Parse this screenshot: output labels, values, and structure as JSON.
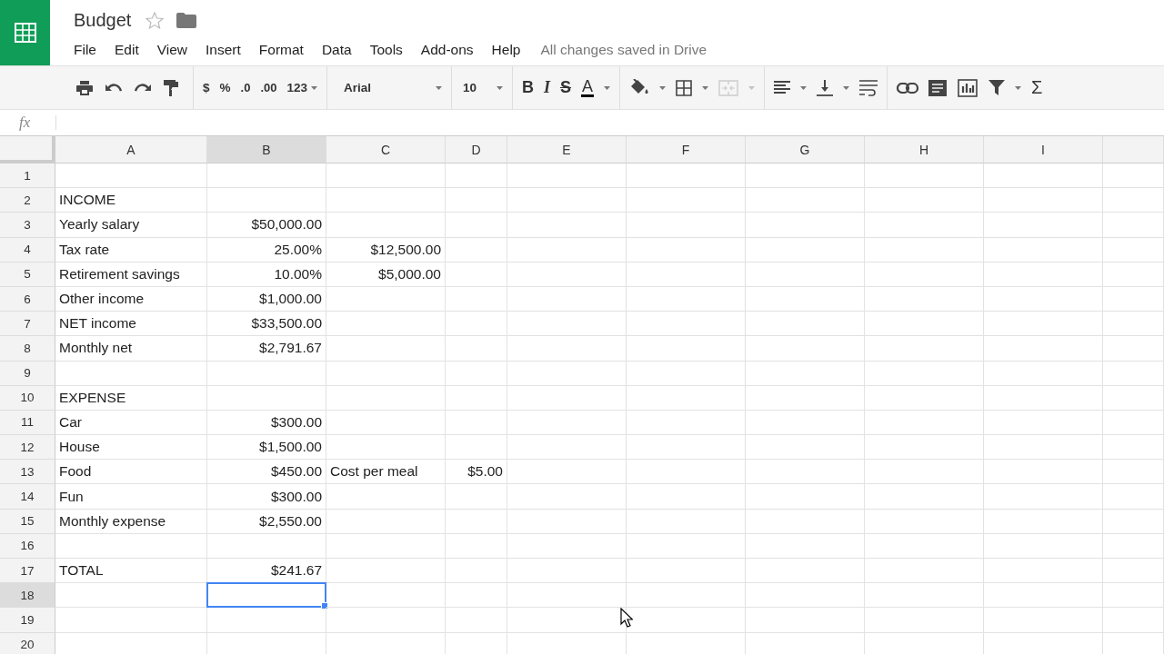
{
  "document": {
    "title": "Budget",
    "starred": false,
    "save_status": "All changes saved in Drive"
  },
  "menus": [
    "File",
    "Edit",
    "View",
    "Insert",
    "Format",
    "Data",
    "Tools",
    "Add-ons",
    "Help"
  ],
  "toolbar": {
    "currency": "$",
    "percent": "%",
    "decrease_decimals": ".0",
    "increase_decimals": ".00",
    "number_format": "123",
    "font": "Arial",
    "font_size": "10",
    "bold": "B",
    "italic": "I",
    "strikethrough": "S",
    "text_color": "A",
    "merge_disabled": true,
    "sum": "Σ"
  },
  "formula_bar": {
    "label": "fx"
  },
  "columns": [
    {
      "label": "A",
      "selected": false
    },
    {
      "label": "B",
      "selected": true
    },
    {
      "label": "C",
      "selected": false
    },
    {
      "label": "D",
      "selected": false
    },
    {
      "label": "E",
      "selected": false
    },
    {
      "label": "F",
      "selected": false
    },
    {
      "label": "G",
      "selected": false
    },
    {
      "label": "H",
      "selected": false
    },
    {
      "label": "I",
      "selected": false
    }
  ],
  "rows": [
    {
      "number": "1",
      "selected": false,
      "cells": []
    },
    {
      "number": "2",
      "selected": false,
      "cells": [
        {
          "kind": "text",
          "text": "INCOME"
        }
      ]
    },
    {
      "number": "3",
      "selected": false,
      "cells": [
        {
          "kind": "text",
          "text": "Yearly salary"
        },
        {
          "kind": "number",
          "text": "$50,000.00"
        }
      ]
    },
    {
      "number": "4",
      "selected": false,
      "cells": [
        {
          "kind": "text",
          "text": "Tax rate"
        },
        {
          "kind": "number",
          "text": "25.00%"
        },
        {
          "kind": "number",
          "text": "$12,500.00"
        }
      ]
    },
    {
      "number": "5",
      "selected": false,
      "cells": [
        {
          "kind": "text",
          "text": "Retirement savings"
        },
        {
          "kind": "number",
          "text": "10.00%"
        },
        {
          "kind": "number",
          "text": "$5,000.00"
        }
      ]
    },
    {
      "number": "6",
      "selected": false,
      "cells": [
        {
          "kind": "text",
          "text": "Other income"
        },
        {
          "kind": "number",
          "text": "$1,000.00"
        }
      ]
    },
    {
      "number": "7",
      "selected": false,
      "cells": [
        {
          "kind": "text",
          "text": "NET income"
        },
        {
          "kind": "number",
          "text": "$33,500.00"
        }
      ]
    },
    {
      "number": "8",
      "selected": false,
      "cells": [
        {
          "kind": "text",
          "text": "Monthly net"
        },
        {
          "kind": "number",
          "text": "$2,791.67"
        }
      ]
    },
    {
      "number": "9",
      "selected": false,
      "cells": []
    },
    {
      "number": "10",
      "selected": false,
      "cells": [
        {
          "kind": "text",
          "text": "EXPENSE"
        }
      ]
    },
    {
      "number": "11",
      "selected": false,
      "cells": [
        {
          "kind": "text",
          "text": "Car"
        },
        {
          "kind": "number",
          "text": "$300.00"
        }
      ]
    },
    {
      "number": "12",
      "selected": false,
      "cells": [
        {
          "kind": "text",
          "text": "House"
        },
        {
          "kind": "number",
          "text": "$1,500.00"
        }
      ]
    },
    {
      "number": "13",
      "selected": false,
      "cells": [
        {
          "kind": "text",
          "text": "Food"
        },
        {
          "kind": "number",
          "text": "$450.00"
        },
        {
          "kind": "text",
          "text": "Cost per meal"
        },
        {
          "kind": "number",
          "text": "$5.00"
        }
      ]
    },
    {
      "number": "14",
      "selected": false,
      "cells": [
        {
          "kind": "text",
          "text": "Fun"
        },
        {
          "kind": "number",
          "text": "$300.00"
        }
      ]
    },
    {
      "number": "15",
      "selected": false,
      "cells": [
        {
          "kind": "text",
          "text": "Monthly expense"
        },
        {
          "kind": "number",
          "text": "$2,550.00"
        }
      ]
    },
    {
      "number": "16",
      "selected": false,
      "cells": []
    },
    {
      "number": "17",
      "selected": false,
      "cells": [
        {
          "kind": "text",
          "text": "TOTAL"
        },
        {
          "kind": "number",
          "text": "$241.67"
        }
      ]
    },
    {
      "number": "18",
      "selected": true,
      "cells": []
    },
    {
      "number": "19",
      "selected": false,
      "cells": []
    },
    {
      "number": "20",
      "selected": false,
      "cells": []
    }
  ]
}
